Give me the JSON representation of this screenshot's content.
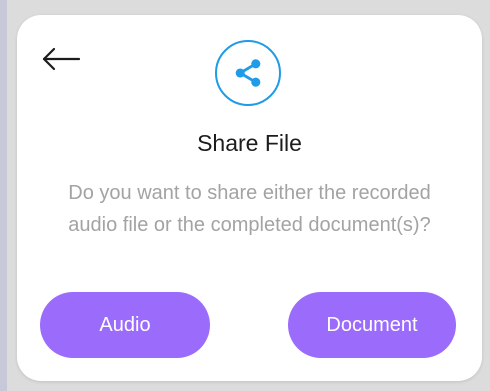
{
  "dialog": {
    "back_icon": "arrow-left-icon",
    "share_icon": "share-icon",
    "title": "Share File",
    "message": "Do you want to share either the recorded audio file or the completed document(s)?",
    "buttons": {
      "audio_label": "Audio",
      "document_label": "Document"
    }
  },
  "colors": {
    "accent": "#9b6bfb",
    "icon_blue": "#1f9be8",
    "text_primary": "#1c1c1c",
    "text_secondary": "#a3a3a3"
  }
}
